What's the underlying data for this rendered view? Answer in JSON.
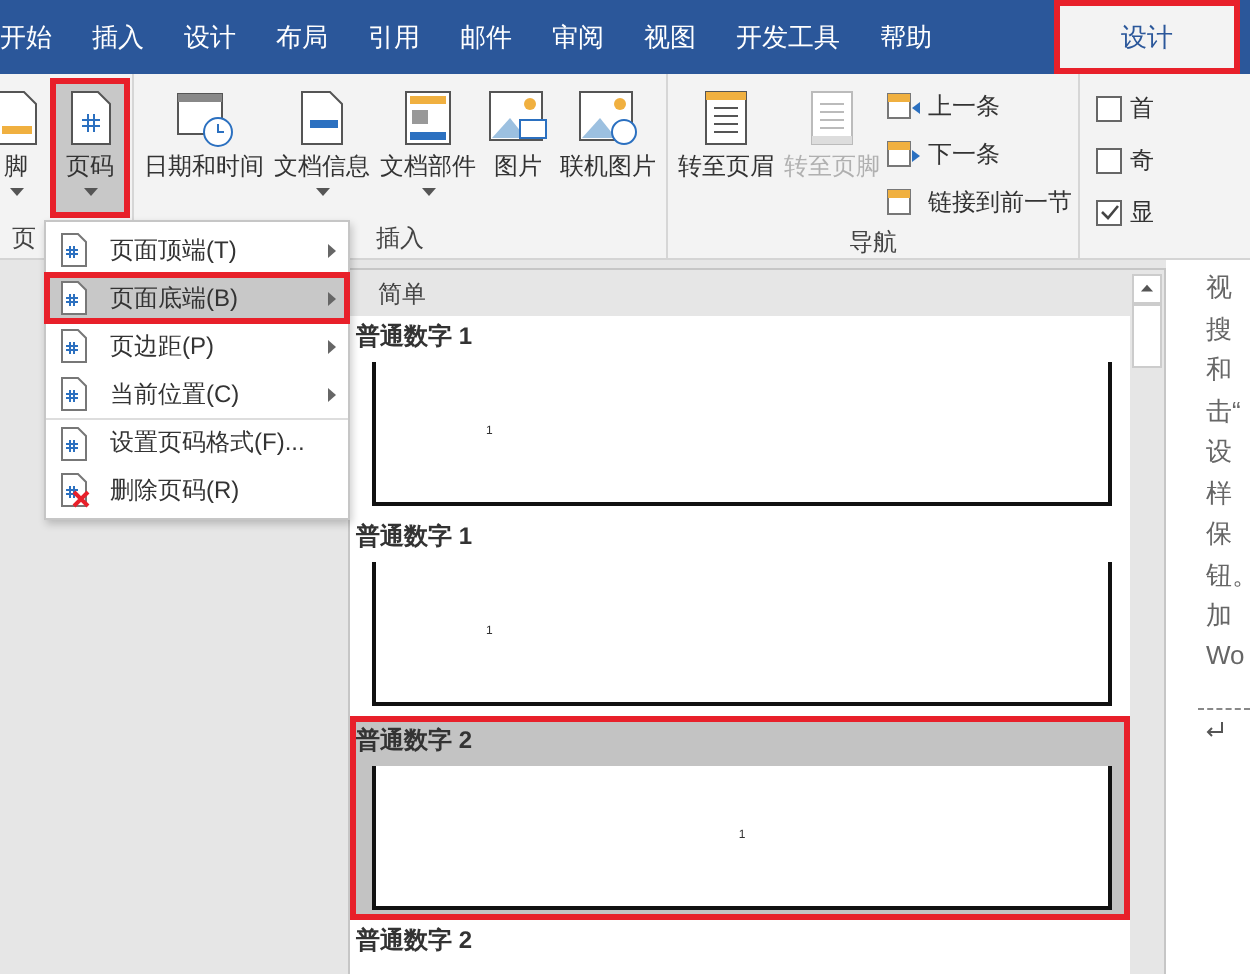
{
  "tabs": [
    {
      "label": "开始",
      "selected": false,
      "kind": "normal"
    },
    {
      "label": "插入",
      "selected": false,
      "kind": "normal"
    },
    {
      "label": "设计",
      "selected": false,
      "kind": "normal"
    },
    {
      "label": "布局",
      "selected": false,
      "kind": "normal"
    },
    {
      "label": "引用",
      "selected": false,
      "kind": "normal"
    },
    {
      "label": "邮件",
      "selected": false,
      "kind": "normal"
    },
    {
      "label": "审阅",
      "selected": false,
      "kind": "normal"
    },
    {
      "label": "视图",
      "selected": false,
      "kind": "normal"
    },
    {
      "label": "开发工具",
      "selected": false,
      "kind": "normal"
    },
    {
      "label": "帮助",
      "selected": false,
      "kind": "normal"
    },
    {
      "label": "设计",
      "selected": true,
      "kind": "contextual"
    }
  ],
  "ribbon": {
    "groups": [
      {
        "label": "页",
        "buttons": [
          {
            "label": "脚",
            "caret": true,
            "selected": false,
            "disabled": false
          },
          {
            "label": "页码",
            "caret": true,
            "selected": true,
            "disabled": false
          }
        ]
      },
      {
        "label": "插入",
        "buttons": [
          {
            "label": "日期和时间",
            "caret": false,
            "selected": false,
            "disabled": false
          },
          {
            "label": "文档信息",
            "caret": true,
            "selected": false,
            "disabled": false
          },
          {
            "label": "文档部件",
            "caret": true,
            "selected": false,
            "disabled": false
          },
          {
            "label": "图片",
            "caret": false,
            "selected": false,
            "disabled": false
          },
          {
            "label": "联机图片",
            "caret": false,
            "selected": false,
            "disabled": false
          }
        ]
      },
      {
        "label": "导航",
        "buttons": [
          {
            "label": "转至页眉",
            "caret": false,
            "selected": false,
            "disabled": false
          },
          {
            "label": "转至页脚",
            "caret": false,
            "selected": false,
            "disabled": true
          }
        ],
        "small": [
          "上一条",
          "下一条",
          "链接到前一节"
        ]
      },
      {
        "options": [
          {
            "label": "首",
            "checked": false
          },
          {
            "label": "奇",
            "checked": false
          },
          {
            "label": "显",
            "checked": true
          }
        ]
      }
    ]
  },
  "menu": [
    {
      "label": "页面顶端(T)",
      "submenu": true,
      "selected": false
    },
    {
      "label": "页面底端(B)",
      "submenu": true,
      "selected": true
    },
    {
      "label": "页边距(P)",
      "submenu": true,
      "selected": false
    },
    {
      "label": "当前位置(C)",
      "submenu": true,
      "selected": false
    },
    {
      "label": "设置页码格式(F)...",
      "submenu": false,
      "selected": false
    },
    {
      "label": "删除页码(R)",
      "submenu": false,
      "selected": false
    }
  ],
  "gallery": {
    "header": "简单",
    "items": [
      {
        "label": "普通数字 1",
        "number": "1",
        "kind": "left",
        "selected": false
      },
      {
        "label": "普通数字 1",
        "number": "1",
        "kind": "left",
        "selected": false
      },
      {
        "label": "普通数字 2",
        "number": "1",
        "kind": "center",
        "selected": true
      },
      {
        "label": "普通数字 2",
        "selected": false
      }
    ]
  },
  "document": {
    "lines": [
      "视",
      "搜",
      "和",
      "击“",
      "设",
      "样",
      "保",
      "钮。",
      "加",
      "Wo"
    ]
  }
}
